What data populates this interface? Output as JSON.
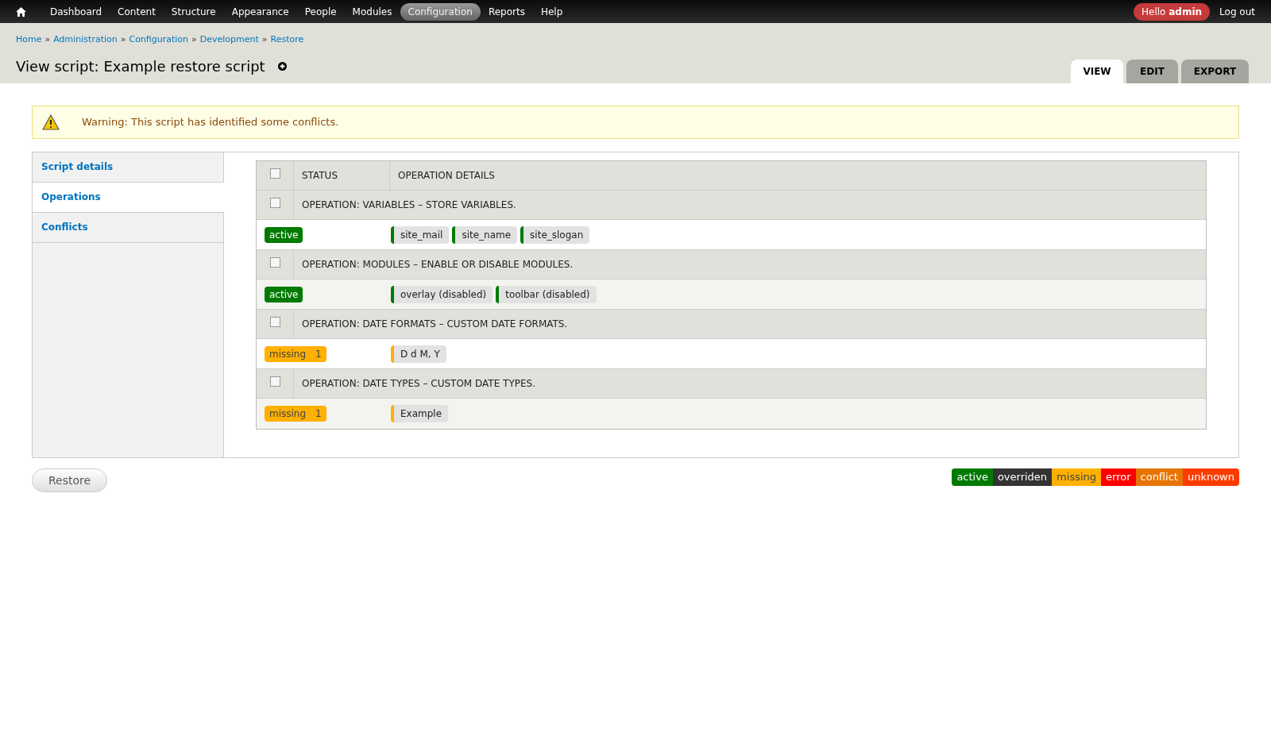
{
  "toolbar": {
    "menu": [
      {
        "label": "Dashboard",
        "selected": false
      },
      {
        "label": "Content",
        "selected": false
      },
      {
        "label": "Structure",
        "selected": false
      },
      {
        "label": "Appearance",
        "selected": false
      },
      {
        "label": "People",
        "selected": false
      },
      {
        "label": "Modules",
        "selected": false
      },
      {
        "label": "Configuration",
        "selected": true
      },
      {
        "label": "Reports",
        "selected": false
      },
      {
        "label": "Help",
        "selected": false
      }
    ],
    "greeting": "Hello **admin**",
    "logout": "Log out"
  },
  "breadcrumb": [
    "Home",
    "Administration",
    "Configuration",
    "Development",
    "Restore"
  ],
  "breadcrumb_separator": "»",
  "title": "View script: Example restore script",
  "tabs": [
    {
      "label": "VIEW",
      "selected": true
    },
    {
      "label": "EDIT",
      "selected": false
    },
    {
      "label": "EXPORT",
      "selected": false
    }
  ],
  "warning": "Warning: This script has identified some conflicts.",
  "sidebar": [
    {
      "label": "Script details",
      "selected": false
    },
    {
      "label": "Operations",
      "selected": true
    },
    {
      "label": "Conflicts",
      "selected": false
    }
  ],
  "table": {
    "header": {
      "checked": false,
      "columns": [
        "STATUS",
        "OPERATION DETAILS"
      ]
    },
    "operations": [
      {
        "title": "OPERATION: VARIABLES – STORE VARIABLES.",
        "checked": false,
        "status": {
          "label": "active",
          "color": "#007a00"
        },
        "items": [
          "site_mail",
          "site_name",
          "site_slogan"
        ]
      },
      {
        "title": "OPERATION: MODULES – ENABLE OR DISABLE MODULES.",
        "checked": false,
        "status": {
          "label": "active",
          "color": "#007a00"
        },
        "items": [
          "overlay (disabled)",
          "toolbar (disabled)"
        ]
      },
      {
        "title": "OPERATION: DATE FORMATS – CUSTOM DATE FORMATS.",
        "checked": false,
        "status": {
          "label": "missing",
          "count": "1",
          "color": "#ffb000"
        },
        "items": [
          "D d M, Y"
        ]
      },
      {
        "title": "OPERATION: DATE TYPES – CUSTOM DATE TYPES.",
        "checked": false,
        "status": {
          "label": "missing",
          "count": "1",
          "color": "#ffb000"
        },
        "items": [
          "Example"
        ]
      }
    ]
  },
  "restore_button": "Restore",
  "legend": [
    {
      "label": "active",
      "color": "#007a00"
    },
    {
      "label": "overriden",
      "color": "#333333"
    },
    {
      "label": "missing",
      "color": "#ffb000"
    },
    {
      "label": "error",
      "color": "#ff0000"
    },
    {
      "label": "conflict",
      "color": "#e87400"
    },
    {
      "label": "unknown",
      "color": "#ff3c00"
    }
  ]
}
